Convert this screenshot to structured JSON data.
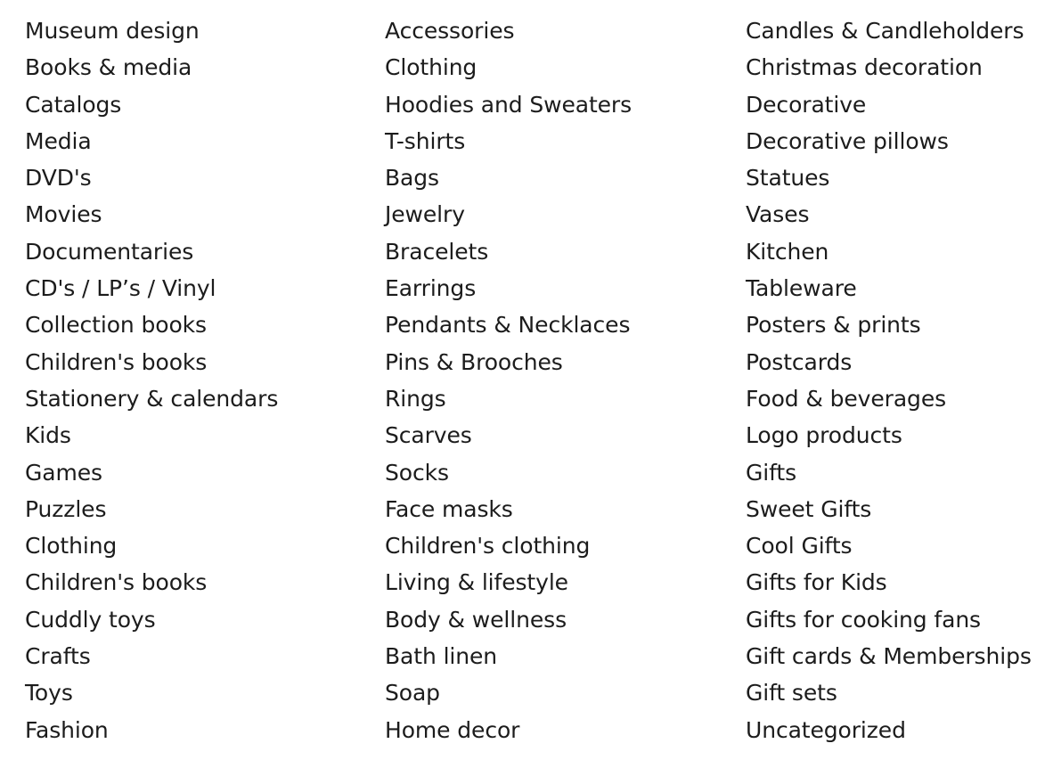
{
  "page": {
    "layout": "three-column-category-list",
    "background_color": "#ffffff",
    "text_color": "#1c1c1c"
  },
  "columns": [
    {
      "name": "column-1",
      "items": [
        "Museum design",
        "Books & media",
        "Catalogs",
        "Media",
        "DVD's",
        "Movies",
        "Documentaries",
        "CD's / LP’s / Vinyl",
        "Collection books",
        "Children's books",
        "Stationery & calendars",
        "Kids",
        "Games",
        "Puzzles",
        "Clothing",
        "Children's books",
        "Cuddly toys",
        "Crafts",
        "Toys",
        "Fashion"
      ]
    },
    {
      "name": "column-2",
      "items": [
        "Accessories",
        "Clothing",
        "Hoodies and Sweaters",
        "T-shirts",
        "Bags",
        "Jewelry",
        "Bracelets",
        "Earrings",
        "Pendants & Necklaces",
        "Pins & Brooches",
        "Rings",
        "Scarves",
        "Socks",
        "Face masks",
        "Children's clothing",
        "Living & lifestyle",
        "Body & wellness",
        "Bath linen",
        "Soap",
        "Home decor"
      ]
    },
    {
      "name": "column-3",
      "items": [
        "Candles & Candleholders",
        "Christmas decoration",
        "Decorative",
        "Decorative pillows",
        "Statues",
        "Vases",
        "Kitchen",
        "Tableware",
        "Posters & prints",
        "Postcards",
        "Food & beverages",
        "Logo products",
        "Gifts",
        "Sweet Gifts",
        "Cool Gifts",
        "Gifts for Kids",
        "Gifts for cooking fans",
        "Gift cards & Memberships",
        "Gift sets",
        "Uncategorized"
      ]
    }
  ]
}
